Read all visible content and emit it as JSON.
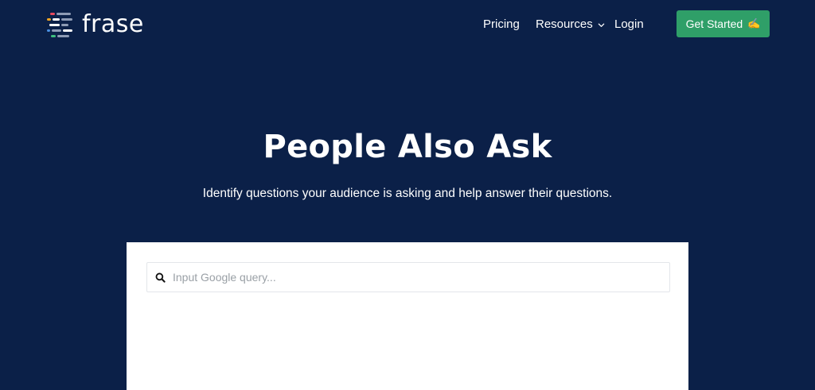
{
  "brand": {
    "name": "frase"
  },
  "nav": {
    "items": [
      {
        "label": "Pricing"
      },
      {
        "label": "Resources"
      },
      {
        "label": "Login"
      }
    ],
    "cta_label": "Get Started",
    "cta_emoji": "✍"
  },
  "hero": {
    "title": "People Also Ask",
    "subtitle": "Identify questions your audience is asking and help answer their questions."
  },
  "search": {
    "placeholder": "Input Google query..."
  },
  "colors": {
    "background": "#0b2048",
    "cta": "#2f9f68",
    "card": "#ffffff"
  }
}
